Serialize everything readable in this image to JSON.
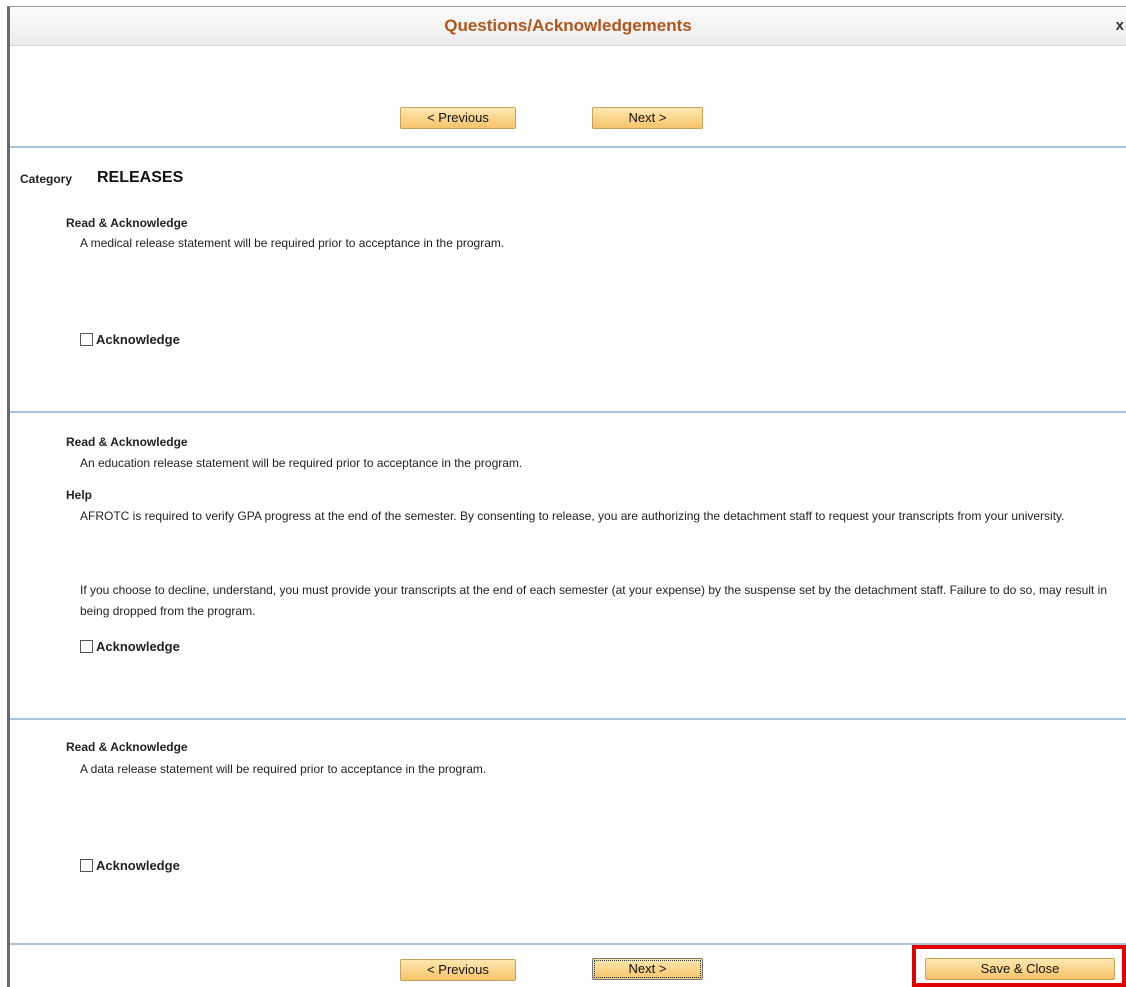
{
  "window": {
    "title": "Questions/Acknowledgements",
    "close_glyph": "x"
  },
  "nav": {
    "previous_label": "< Previous",
    "next_label": "Next >",
    "save_close_label": "Save & Close"
  },
  "category": {
    "label": "Category",
    "value": "RELEASES"
  },
  "items": [
    {
      "heading": "Read & Acknowledge",
      "statement": "A medical release statement will be required prior to acceptance in the program.",
      "acknowledge_label": "Acknowledge"
    },
    {
      "heading": "Read & Acknowledge",
      "statement": "An education release statement will be required prior to acceptance in the program.",
      "help_heading": "Help",
      "help_paragraph_1": "AFROTC is required to verify GPA progress at the end of the semester.  By consenting to release, you are authorizing the detachment staff to request your transcripts from your university.",
      "help_paragraph_2": "If you choose to decline, understand, you must provide your transcripts at the end of each semester (at your expense) by the suspense set by the detachment staff.  Failure to do so, may result in being dropped from the program.",
      "acknowledge_label": "Acknowledge"
    },
    {
      "heading": "Read & Acknowledge",
      "statement": "A data release statement will be required prior to acceptance in the program.",
      "acknowledge_label": "Acknowledge"
    }
  ],
  "colors": {
    "title": "#b0561a",
    "button": "#f6c36a",
    "separator": "#a9c3dc",
    "highlight": "#e00000"
  }
}
